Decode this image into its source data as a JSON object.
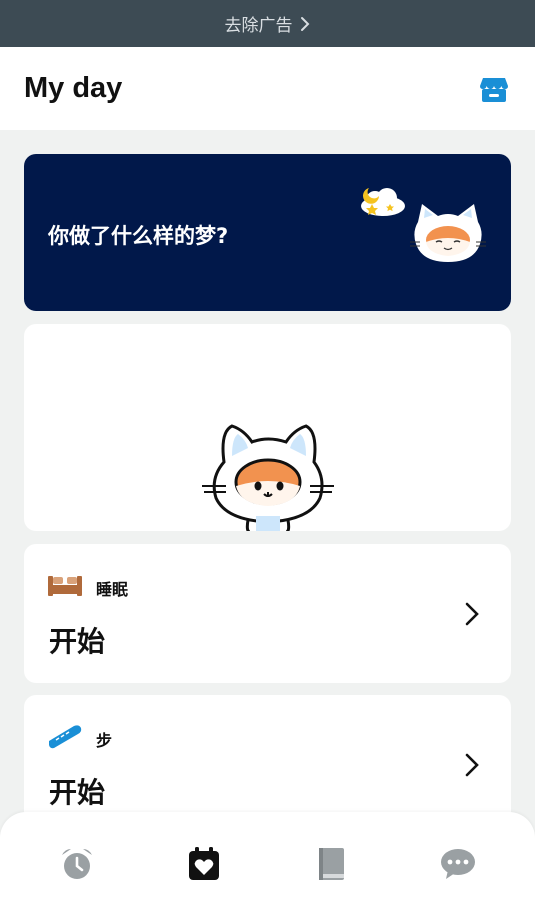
{
  "ad_bar": {
    "label": "去除广告"
  },
  "header": {
    "title": "My day",
    "shop_icon": "shop-icon"
  },
  "dream_card": {
    "question": "你做了什么样的梦?"
  },
  "sleep_card": {
    "label": "睡眠",
    "value": "开始",
    "icon": "bed-icon"
  },
  "steps_card": {
    "label": "步",
    "value": "开始",
    "icon": "shoe-icon"
  },
  "tabbar": {
    "tabs": [
      {
        "name": "alarm",
        "icon": "alarm-clock-icon",
        "active": false
      },
      {
        "name": "my-day",
        "icon": "calendar-heart-icon",
        "active": true
      },
      {
        "name": "journal",
        "icon": "book-icon",
        "active": false
      },
      {
        "name": "chat",
        "icon": "chat-bubble-icon",
        "active": false
      }
    ]
  },
  "colors": {
    "ad_bar_bg": "#3d4b54",
    "dream_card_bg": "#01184a",
    "accent_blue": "#1a8fd6",
    "tab_inactive": "#9aa0a3",
    "tab_active": "#111111"
  }
}
